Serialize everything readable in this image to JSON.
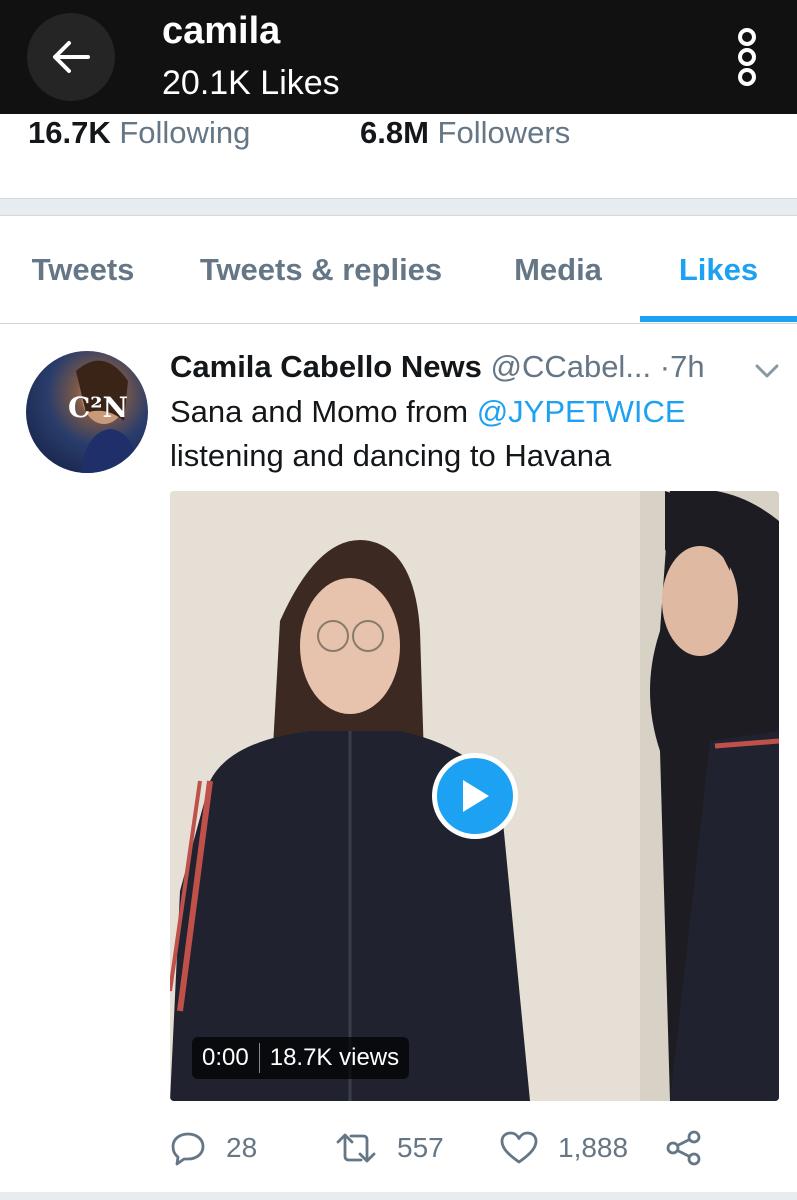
{
  "header": {
    "title": "camila",
    "subtitle": "20.1K Likes",
    "back_icon": "arrow-left-icon",
    "more_icon": "vertical-dots-icon"
  },
  "stats": {
    "following_count": "16.7K",
    "following_label": "Following",
    "followers_count": "6.8M",
    "followers_label": "Followers"
  },
  "tabs": [
    {
      "label": "Tweets",
      "active": false
    },
    {
      "label": "Tweets & replies",
      "active": false
    },
    {
      "label": "Media",
      "active": false
    },
    {
      "label": "Likes",
      "active": true
    }
  ],
  "tweet": {
    "author": "Camila Cabello News",
    "handle": "@CCabel...",
    "separator": "·",
    "time": "7h",
    "text_before": "Sana and Momo from ",
    "mention": "@JYPETWICE",
    "text_after": "listening and dancing to Havana",
    "media": {
      "duration": "0:00",
      "views": "18.7K views"
    },
    "actions": {
      "replies": "28",
      "retweets": "557",
      "likes": "1,888"
    }
  },
  "colors": {
    "accent": "#1da1f2",
    "header_bg": "#111111",
    "muted": "#657786"
  }
}
